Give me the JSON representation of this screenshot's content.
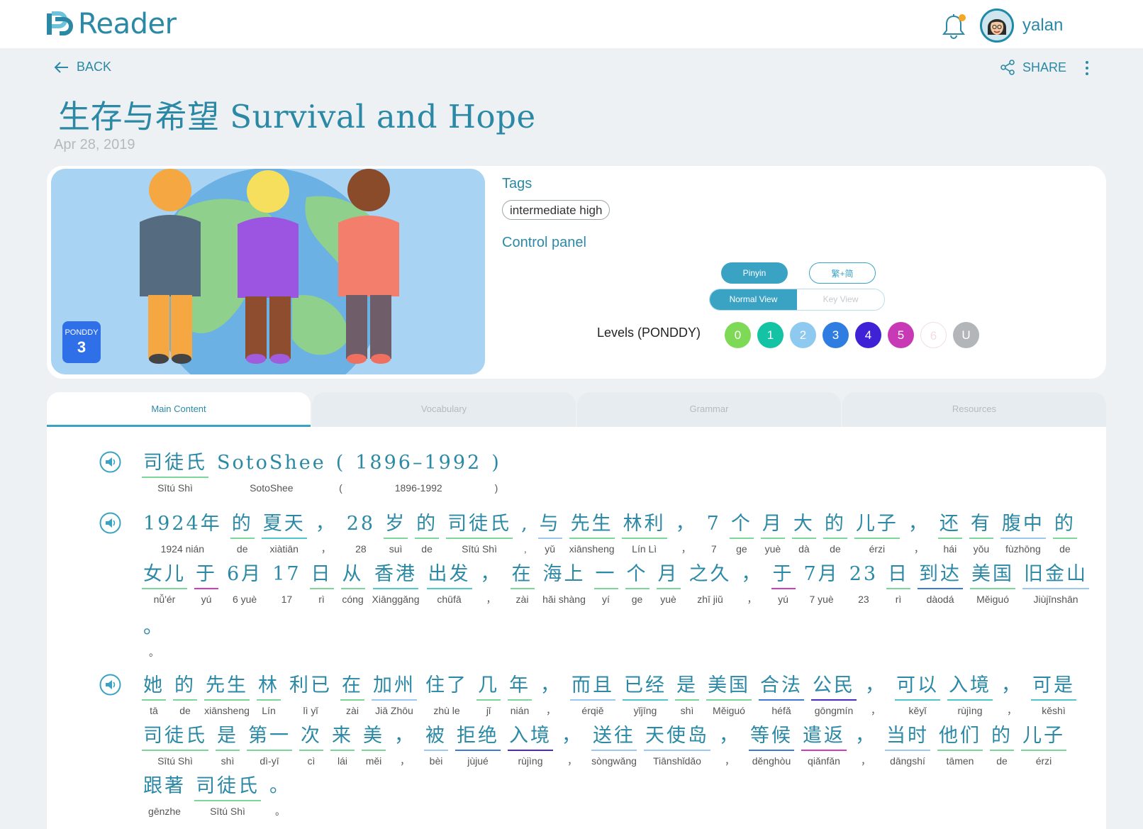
{
  "app": {
    "name": "Reader"
  },
  "user": {
    "name": "yalan"
  },
  "nav": {
    "back_label": "BACK",
    "share_label": "SHARE"
  },
  "article": {
    "title": "生存与希望 Survival and Hope",
    "date": "Apr 28, 2019",
    "level_badge": {
      "system": "PONDDY",
      "level": "3"
    }
  },
  "info": {
    "tags_label": "Tags",
    "tags": [
      "intermediate high"
    ],
    "control_panel_label": "Control panel",
    "pinyin_button": "Pinyin",
    "script_button": "繁+简",
    "view_options": [
      "Normal View",
      "Key View"
    ],
    "active_view": "Normal View",
    "levels_label": "Levels (PONDDY)",
    "levels": [
      {
        "label": "0",
        "color": "#7ed957"
      },
      {
        "label": "1",
        "color": "#14c3a4"
      },
      {
        "label": "2",
        "color": "#8ec9f0"
      },
      {
        "label": "3",
        "color": "#2f7de0"
      },
      {
        "label": "4",
        "color": "#4022d6"
      },
      {
        "label": "5",
        "color": "#c83ab5"
      },
      {
        "label": "6",
        "color": "#ffffff"
      },
      {
        "label": "U",
        "color": "#b3b6b8"
      }
    ]
  },
  "tabs": [
    "Main Content",
    "Vocabulary",
    "Grammar",
    "Resources"
  ],
  "active_tab": "Main Content",
  "content": {
    "lines": [
      [
        {
          "h": "司徒氏",
          "p": "Sītú Shì",
          "u": "g"
        },
        {
          "h": "SotoShee",
          "p": "SotoShee",
          "plain": true
        },
        {
          "h": "(",
          "p": "(",
          "plain": true
        },
        {
          "h": "1896–1992",
          "p": "1896-1992",
          "plain": true
        },
        {
          "h": ")",
          "p": ")",
          "plain": true
        }
      ],
      [
        {
          "h": "1924年",
          "p": "1924 nián",
          "plain": true
        },
        {
          "h": "的",
          "p": "de",
          "u": "g"
        },
        {
          "h": "夏天",
          "p": "xiàtiān",
          "u": "t"
        },
        {
          "h": "，",
          "p": "，",
          "plain": true
        },
        {
          "h": "28",
          "p": "28",
          "plain": true
        },
        {
          "h": "岁",
          "p": "suì",
          "u": "g"
        },
        {
          "h": "的",
          "p": "de",
          "u": "g"
        },
        {
          "h": "司徒氏",
          "p": "Sītú Shì",
          "u": "g"
        },
        {
          "h": ",",
          "p": ",",
          "plain": true
        },
        {
          "h": "与",
          "p": "yǔ",
          "u": "b"
        },
        {
          "h": "先生",
          "p": "xiānsheng",
          "u": "g"
        },
        {
          "h": "林利",
          "p": "Lín Lì",
          "u": "g"
        },
        {
          "h": "，",
          "p": "，",
          "plain": true
        },
        {
          "h": "7",
          "p": "7",
          "plain": true
        },
        {
          "h": "个",
          "p": "ge",
          "u": "g"
        },
        {
          "h": "月",
          "p": "yuè",
          "u": "g"
        },
        {
          "h": "大",
          "p": "dà",
          "u": "g"
        },
        {
          "h": "的",
          "p": "de",
          "u": "g"
        },
        {
          "h": "儿子",
          "p": "érzi",
          "u": "g"
        },
        {
          "h": "，",
          "p": "，",
          "plain": true
        },
        {
          "h": "还",
          "p": "hái",
          "u": "g"
        },
        {
          "h": "有",
          "p": "yǒu",
          "u": "g"
        },
        {
          "h": "腹中",
          "p": "fùzhōng",
          "u": "b"
        },
        {
          "h": "的",
          "p": "de",
          "u": "g"
        }
      ],
      [
        {
          "h": "女儿",
          "p": "nǚ'ér",
          "u": "g"
        },
        {
          "h": "于",
          "p": "yú",
          "u": "m"
        },
        {
          "h": "6月",
          "p": "6 yuè",
          "plain": true
        },
        {
          "h": "17",
          "p": "17",
          "plain": true
        },
        {
          "h": "日",
          "p": "rì",
          "u": "g"
        },
        {
          "h": "从",
          "p": "cóng",
          "u": "g"
        },
        {
          "h": "香港",
          "p": "Xiānggǎng",
          "u": "t"
        },
        {
          "h": "出发",
          "p": "chūfā",
          "u": "t"
        },
        {
          "h": "，",
          "p": "，",
          "plain": true
        },
        {
          "h": "在",
          "p": "zài",
          "u": "g"
        },
        {
          "h": "海上",
          "p": "hǎi shàng",
          "plain": true
        },
        {
          "h": "一",
          "p": "yí",
          "u": "g"
        },
        {
          "h": "个",
          "p": "ge",
          "u": "g"
        },
        {
          "h": "月",
          "p": "yuè",
          "u": "g"
        },
        {
          "h": "之久",
          "p": "zhī jiǔ",
          "plain": true
        },
        {
          "h": "，",
          "p": "，",
          "plain": true
        },
        {
          "h": "于",
          "p": "yú",
          "u": "m"
        },
        {
          "h": "7月",
          "p": "7 yuè",
          "plain": true
        },
        {
          "h": "23",
          "p": "23",
          "plain": true
        },
        {
          "h": "日",
          "p": "rì",
          "u": "g"
        },
        {
          "h": "到达",
          "p": "dàodá",
          "u": "d"
        },
        {
          "h": "美国",
          "p": "Měiguó",
          "u": "g"
        },
        {
          "h": "旧金山",
          "p": "Jiùjīnshān",
          "u": "b"
        }
      ],
      [
        {
          "h": "。",
          "p": "。",
          "plain": true
        }
      ],
      [
        {
          "h": "她",
          "p": "tā",
          "u": "g"
        },
        {
          "h": "的",
          "p": "de",
          "u": "g"
        },
        {
          "h": "先生",
          "p": "xiānsheng",
          "u": "g"
        },
        {
          "h": "林",
          "p": "Lín",
          "u": "g"
        },
        {
          "h": "利已",
          "p": "lì yǐ",
          "plain": true
        },
        {
          "h": "在",
          "p": "zài",
          "u": "g"
        },
        {
          "h": "加州",
          "p": "Jiā Zhōu",
          "u": "b"
        },
        {
          "h": "住了",
          "p": "zhù le",
          "plain": true
        },
        {
          "h": "几",
          "p": "jǐ",
          "u": "g"
        },
        {
          "h": "年",
          "p": "nián",
          "u": "g"
        },
        {
          "h": "，",
          "p": "，",
          "plain": true
        },
        {
          "h": "而且",
          "p": "érqiě",
          "u": "b"
        },
        {
          "h": "已经",
          "p": "yǐjīng",
          "u": "t"
        },
        {
          "h": "是",
          "p": "shì",
          "u": "g"
        },
        {
          "h": "美国",
          "p": "Měiguó",
          "u": "g"
        },
        {
          "h": "合法",
          "p": "héfǎ",
          "u": "d"
        },
        {
          "h": "公民",
          "p": "gōngmín",
          "u": "v"
        },
        {
          "h": "，",
          "p": "，",
          "plain": true
        },
        {
          "h": "可以",
          "p": "kěyǐ",
          "u": "t"
        },
        {
          "h": "入境",
          "p": "rùjìng",
          "u": "t"
        },
        {
          "h": "，",
          "p": "，",
          "plain": true
        },
        {
          "h": "可是",
          "p": "kěshì",
          "u": "t"
        }
      ],
      [
        {
          "h": "司徒氏",
          "p": "Sītú Shì",
          "u": "g"
        },
        {
          "h": "是",
          "p": "shì",
          "u": "g"
        },
        {
          "h": "第一",
          "p": "dì-yī",
          "u": "g"
        },
        {
          "h": "次",
          "p": "cì",
          "u": "g"
        },
        {
          "h": "来",
          "p": "lái",
          "u": "g"
        },
        {
          "h": "美",
          "p": "měi",
          "u": "g"
        },
        {
          "h": "，",
          "p": "，",
          "plain": true
        },
        {
          "h": "被",
          "p": "bèi",
          "u": "b"
        },
        {
          "h": "拒绝",
          "p": "jùjué",
          "u": "d"
        },
        {
          "h": "入境",
          "p": "rùjìng",
          "u": "v"
        },
        {
          "h": "，",
          "p": "，",
          "plain": true
        },
        {
          "h": "送往",
          "p": "sòngwǎng",
          "u": "b"
        },
        {
          "h": "天使岛",
          "p": "Tiānshǐdǎo",
          "u": "b"
        },
        {
          "h": "，",
          "p": "，",
          "plain": true
        },
        {
          "h": "等候",
          "p": "děnghòu",
          "u": "d"
        },
        {
          "h": "遣返",
          "p": "qiǎnfǎn",
          "u": "m"
        },
        {
          "h": "，",
          "p": "，",
          "plain": true
        },
        {
          "h": "当时",
          "p": "dāngshí",
          "u": "b"
        },
        {
          "h": "他们",
          "p": "tāmen",
          "u": "g"
        },
        {
          "h": "的",
          "p": "de",
          "u": "g"
        },
        {
          "h": "儿子",
          "p": "érzi",
          "u": "g"
        }
      ],
      [
        {
          "h": "跟著",
          "p": "gēnzhe",
          "plain": true
        },
        {
          "h": "司徒氏",
          "p": "Sītú Shì",
          "u": "g"
        },
        {
          "h": "。",
          "p": "。",
          "plain": true
        }
      ]
    ]
  },
  "colors": {
    "accent": "#2b89a6",
    "button": "#3aa3c4",
    "badge": "#2f6fe8",
    "notification": "#f5a623"
  }
}
